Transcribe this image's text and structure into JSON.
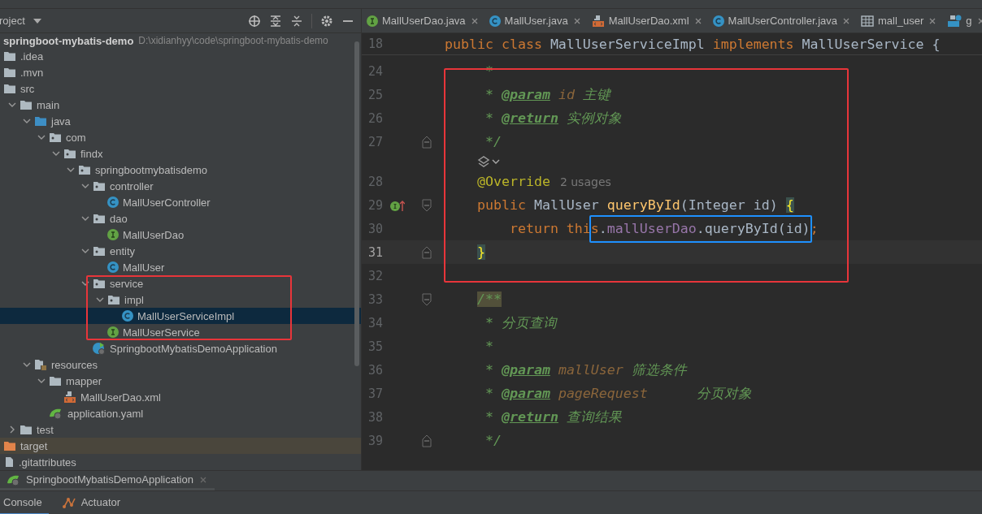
{
  "project_panel": {
    "title": "roject",
    "root": {
      "name": "springboot-mybatis-demo",
      "path": "D:\\xidianhyy\\code\\springboot-mybatis-demo"
    },
    "tree": [
      {
        "label": ".idea",
        "kind": "folder",
        "selected": false
      },
      {
        "label": ".mvn",
        "kind": "folder",
        "selected": false
      },
      {
        "label": "src",
        "kind": "folder",
        "selected": false,
        "children": [
          {
            "label": "main",
            "kind": "folder",
            "selected": false,
            "expanded": true,
            "children": [
              {
                "label": "java",
                "kind": "source",
                "selected": false,
                "expanded": true,
                "children": [
                  {
                    "label": "com",
                    "kind": "package",
                    "selected": false,
                    "expanded": true,
                    "children": [
                      {
                        "label": "findx",
                        "kind": "package",
                        "selected": false,
                        "expanded": true,
                        "children": [
                          {
                            "label": "springbootmybatisdemo",
                            "kind": "package",
                            "selected": false,
                            "expanded": true,
                            "children": [
                              {
                                "label": "controller",
                                "kind": "package",
                                "selected": false,
                                "expanded": true,
                                "children": [
                                  {
                                    "label": "MallUserController",
                                    "kind": "class",
                                    "selected": false
                                  }
                                ]
                              },
                              {
                                "label": "dao",
                                "kind": "package",
                                "selected": false,
                                "expanded": true,
                                "children": [
                                  {
                                    "label": "MallUserDao",
                                    "kind": "interface",
                                    "selected": false
                                  }
                                ]
                              },
                              {
                                "label": "entity",
                                "kind": "package",
                                "selected": false,
                                "expanded": true,
                                "children": [
                                  {
                                    "label": "MallUser",
                                    "kind": "class",
                                    "selected": false
                                  }
                                ]
                              },
                              {
                                "label": "service",
                                "kind": "package",
                                "selected": false,
                                "expanded": true,
                                "children": [
                                  {
                                    "label": "impl",
                                    "kind": "package",
                                    "selected": false,
                                    "expanded": true,
                                    "children": [
                                      {
                                        "label": "MallUserServiceImpl",
                                        "kind": "class",
                                        "selected": true
                                      }
                                    ]
                                  },
                                  {
                                    "label": "MallUserService",
                                    "kind": "interface",
                                    "selected": false
                                  }
                                ]
                              },
                              {
                                "label": "SpringbootMybatisDemoApplication",
                                "kind": "spring_class",
                                "selected": false
                              }
                            ]
                          }
                        ]
                      }
                    ]
                  }
                ]
              },
              {
                "label": "resources",
                "kind": "resources",
                "selected": false,
                "expanded": true,
                "children": [
                  {
                    "label": "mapper",
                    "kind": "folder",
                    "selected": false,
                    "expanded": true,
                    "children": [
                      {
                        "label": "MallUserDao.xml",
                        "kind": "xml",
                        "selected": false
                      }
                    ]
                  },
                  {
                    "label": "application.yaml",
                    "kind": "yaml",
                    "selected": false
                  }
                ]
              }
            ]
          },
          {
            "label": "test",
            "kind": "folder",
            "selected": false,
            "expanded": false
          }
        ]
      },
      {
        "label": "target",
        "kind": "excluded",
        "selected": false
      },
      {
        "label": ".gitattributes",
        "kind": "file",
        "selected": false
      }
    ],
    "highlight_boxes": [
      {
        "color": "#e8353a"
      }
    ]
  },
  "editor_tabs": [
    {
      "label": "MallUserDao.java",
      "kind": "interface"
    },
    {
      "label": "MallUser.java",
      "kind": "class"
    },
    {
      "label": "MallUserDao.xml",
      "kind": "xml"
    },
    {
      "label": "MallUserController.java",
      "kind": "class"
    },
    {
      "label": "mall_user",
      "kind": "table"
    },
    {
      "label": "g",
      "kind": "api"
    }
  ],
  "editor": {
    "sticky_line": {
      "number": "18",
      "tokens": [
        {
          "kind": "keyword",
          "text": "public class "
        },
        {
          "kind": "plain",
          "text": "MallUserServiceImpl "
        },
        {
          "kind": "keyword",
          "text": "implements "
        },
        {
          "kind": "plain",
          "text": "MallUserService {"
        }
      ]
    },
    "lines": [
      {
        "kind": "code",
        "number": "24",
        "current": false,
        "tokens": [
          {
            "kind": "comment",
            "text": "     *"
          }
        ]
      },
      {
        "kind": "code",
        "number": "25",
        "current": false,
        "tokens": [
          {
            "kind": "comment",
            "text": "     * "
          },
          {
            "kind": "doc_tag",
            "text": "@param"
          },
          {
            "kind": "doc_param",
            "text": " id"
          },
          {
            "kind": "comment",
            "text": " 主键"
          }
        ]
      },
      {
        "kind": "code",
        "number": "26",
        "current": false,
        "tokens": [
          {
            "kind": "comment",
            "text": "     * "
          },
          {
            "kind": "doc_tag",
            "text": "@return"
          },
          {
            "kind": "comment",
            "text": " 实例对象"
          }
        ]
      },
      {
        "kind": "code",
        "number": "27",
        "current": false,
        "gutter_icons": [
          {
            "kind": "fold_end"
          }
        ],
        "tokens": [
          {
            "kind": "comment",
            "text": "     */"
          }
        ]
      },
      {
        "kind": "inlay"
      },
      {
        "kind": "code",
        "number": "28",
        "current": false,
        "tokens": [
          {
            "kind": "annotation",
            "text": "    @Override"
          },
          {
            "kind": "hint",
            "text": "2 usages"
          }
        ]
      },
      {
        "kind": "code",
        "number": "29",
        "current": false,
        "gutter_icons": [
          {
            "kind": "implements"
          },
          {
            "kind": "fold_start"
          }
        ],
        "tokens": [
          {
            "kind": "keyword",
            "text": "    public "
          },
          {
            "kind": "plain",
            "text": "MallUser "
          },
          {
            "kind": "method",
            "text": "queryById"
          },
          {
            "kind": "plain",
            "text": "(Integer id) "
          },
          {
            "kind": "brace_match",
            "text": "{"
          }
        ]
      },
      {
        "kind": "code",
        "number": "30",
        "current": false,
        "tokens": [
          {
            "kind": "keyword",
            "text": "        return this"
          },
          {
            "kind": "plain",
            "text": "."
          },
          {
            "kind": "field",
            "text": "mallUserDao"
          },
          {
            "kind": "plain",
            "text": ".queryById(id)"
          },
          {
            "kind": "keyword",
            "text": ";"
          }
        ]
      },
      {
        "kind": "code",
        "number": "31",
        "current": true,
        "gutter_icons": [
          {
            "kind": "fold_end"
          }
        ],
        "tokens": [
          {
            "kind": "brace_match",
            "text": "    }"
          }
        ]
      },
      {
        "kind": "code",
        "number": "32",
        "current": false
      },
      {
        "kind": "code",
        "number": "33",
        "current": false,
        "gutter_icons": [
          {
            "kind": "fold_start"
          }
        ],
        "tokens": [
          {
            "kind": "comment_match",
            "text": "    /**"
          }
        ]
      },
      {
        "kind": "code",
        "number": "34",
        "current": false,
        "tokens": [
          {
            "kind": "comment",
            "text": "     * 分页查询"
          }
        ]
      },
      {
        "kind": "code",
        "number": "35",
        "current": false,
        "tokens": [
          {
            "kind": "comment",
            "text": "     *"
          }
        ]
      },
      {
        "kind": "code",
        "number": "36",
        "current": false,
        "tokens": [
          {
            "kind": "comment",
            "text": "     * "
          },
          {
            "kind": "doc_tag",
            "text": "@param"
          },
          {
            "kind": "doc_param",
            "text": " mallUser"
          },
          {
            "kind": "comment",
            "text": " 筛选条件"
          }
        ]
      },
      {
        "kind": "code",
        "number": "37",
        "current": false,
        "tokens": [
          {
            "kind": "comment",
            "text": "     * "
          },
          {
            "kind": "doc_tag",
            "text": "@param"
          },
          {
            "kind": "doc_param",
            "text": " pageRequest"
          },
          {
            "kind": "comment",
            "text": "      分页对象"
          }
        ]
      },
      {
        "kind": "code",
        "number": "38",
        "current": false,
        "tokens": [
          {
            "kind": "comment",
            "text": "     * "
          },
          {
            "kind": "doc_tag",
            "text": "@return"
          },
          {
            "kind": "comment",
            "text": " 查询结果"
          }
        ]
      },
      {
        "kind": "code",
        "number": "39",
        "current": false,
        "gutter_icons": [
          {
            "kind": "fold_end"
          }
        ],
        "tokens": [
          {
            "kind": "comment",
            "text": "     */"
          }
        ]
      }
    ],
    "highlight_boxes": [
      {
        "color": "#e8353a"
      },
      {
        "color": "#1e90ff"
      }
    ]
  },
  "run_tabs": [
    {
      "label": "SpringbootMybatisDemoApplication"
    }
  ],
  "tool_tabs": [
    {
      "label": "Console",
      "selected": true,
      "kind": "plain"
    },
    {
      "label": "Actuator",
      "selected": false,
      "kind": "actuator"
    }
  ]
}
